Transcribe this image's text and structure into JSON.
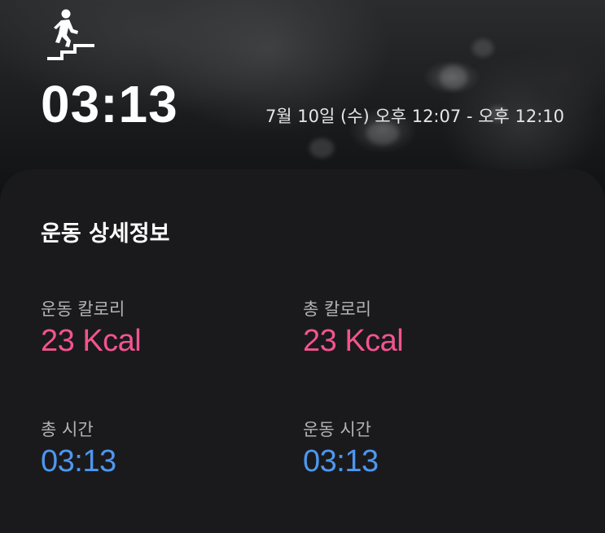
{
  "header": {
    "icon": "stairs-walking-icon",
    "duration": "03:13",
    "time_range": "7월 10일 (수) 오후 12:07 - 오후 12:10"
  },
  "details": {
    "title": "운동 상세정보",
    "metrics": [
      {
        "label": "운동 칼로리",
        "value": "23 Kcal",
        "color": "#f2548f"
      },
      {
        "label": "총 칼로리",
        "value": "23 Kcal",
        "color": "#f2548f"
      },
      {
        "label": "총 시간",
        "value": "03:13",
        "color": "#4d97f0"
      },
      {
        "label": "운동 시간",
        "value": "03:13",
        "color": "#4d97f0"
      }
    ]
  }
}
